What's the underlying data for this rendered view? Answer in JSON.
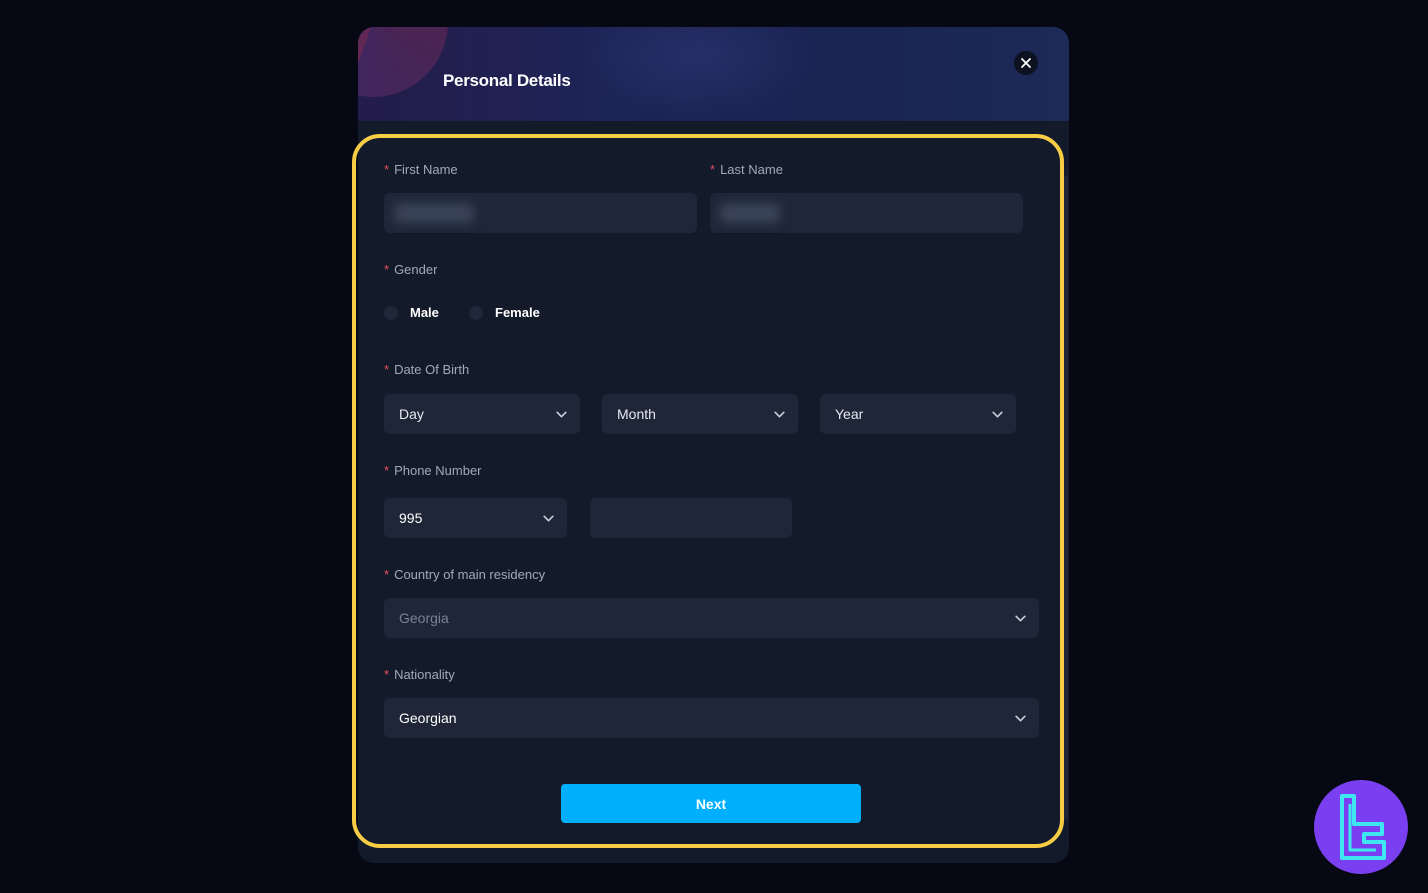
{
  "dialog": {
    "title": "Personal Details"
  },
  "form": {
    "first_name": {
      "label": "First Name",
      "required": "*"
    },
    "last_name": {
      "label": "Last Name",
      "required": "*"
    },
    "gender": {
      "label": "Gender",
      "required": "*",
      "options": [
        "Male",
        "Female"
      ]
    },
    "date_of_birth": {
      "label": "Date Of Birth",
      "required": "*",
      "day": "Day",
      "month": "Month",
      "year": "Year"
    },
    "phone_number": {
      "label": "Phone Number",
      "required": "*",
      "code": "995"
    },
    "country": {
      "label": "Country of main residency",
      "required": "*",
      "value": "Georgia"
    },
    "nationality": {
      "label": "Nationality",
      "required": "*",
      "value": "Georgian"
    },
    "next_label": "Next"
  },
  "colors": {
    "accent": "#00b0ff",
    "highlight": "#f7cd45",
    "required": "#e8505b",
    "logo": "#7b3ff2"
  },
  "icons": [
    "close-icon",
    "chevron-down-icon",
    "brand-logo-icon"
  ]
}
